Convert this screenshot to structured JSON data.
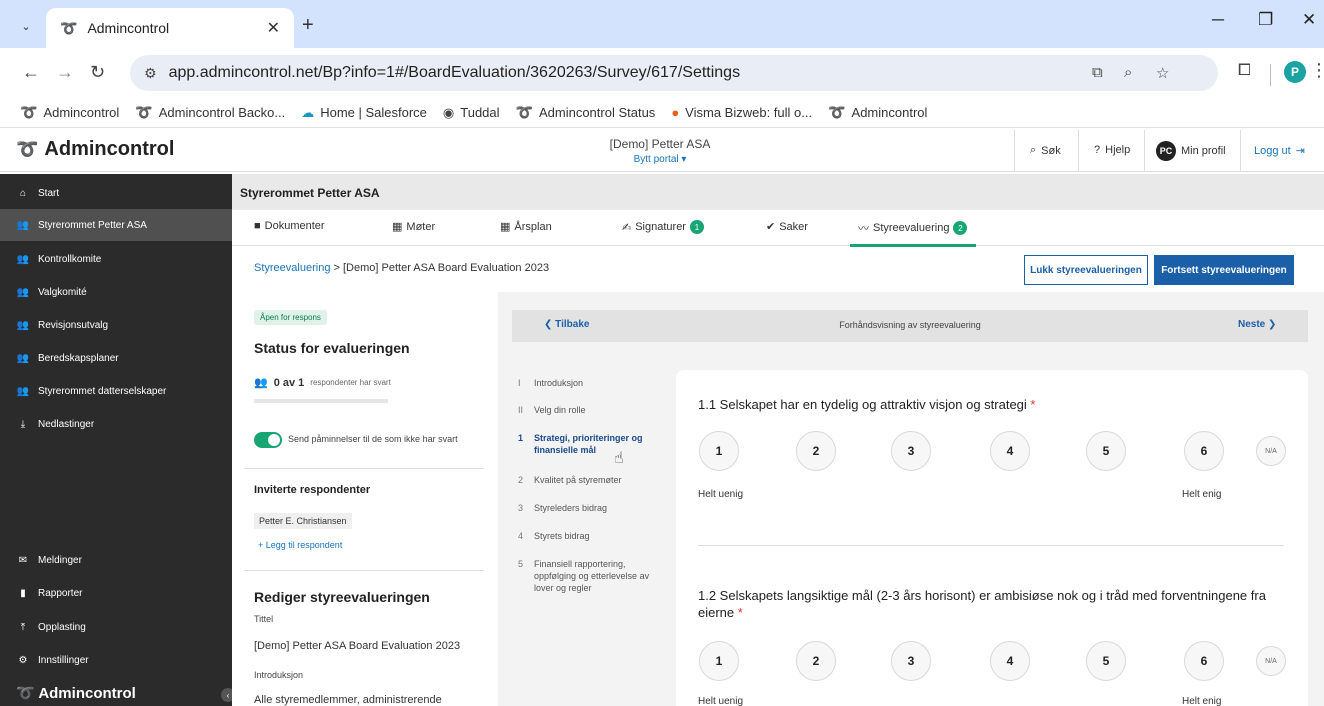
{
  "browser": {
    "tab_title": "Admincontrol",
    "url": "app.admincontrol.net/Bp?info=1#/BoardEvaluation/3620263/Survey/617/Settings",
    "profile_initial": "P",
    "bookmarks": [
      {
        "label": "Admincontrol",
        "icon": "admincontrol-swirl-icon"
      },
      {
        "label": "Admincontrol Backo...",
        "icon": "admincontrol-swirl-icon"
      },
      {
        "label": "Home | Salesforce",
        "icon": "salesforce-cloud-icon"
      },
      {
        "label": "Tuddal",
        "icon": "globe-icon"
      },
      {
        "label": "Admincontrol Status",
        "icon": "admincontrol-swirl-icon"
      },
      {
        "label": "Visma Bizweb: full o...",
        "icon": "visma-icon"
      },
      {
        "label": "Admincontrol",
        "icon": "admincontrol-swirl-icon"
      }
    ]
  },
  "header": {
    "brand": "Admincontrol",
    "org": "[Demo] Petter ASA",
    "switch_portal": "Bytt portal ▾",
    "search": "Søk",
    "help": "Hjelp",
    "profile_initials": "PC",
    "profile": "Min profil",
    "logout": "Logg ut"
  },
  "sidebar": {
    "items": [
      {
        "label": "Start",
        "icon": "home-icon"
      },
      {
        "label": "Styrerommet Petter ASA",
        "icon": "group-icon"
      },
      {
        "label": "Kontrollkomite",
        "icon": "group-icon"
      },
      {
        "label": "Valgkomité",
        "icon": "group-icon"
      },
      {
        "label": "Revisjonsutvalg",
        "icon": "group-icon"
      },
      {
        "label": "Beredskapsplaner",
        "icon": "group-icon"
      },
      {
        "label": "Styrerommet datterselskaper",
        "icon": "group-icon"
      },
      {
        "label": "Nedlastinger",
        "icon": "download-icon"
      }
    ],
    "bottom_items": [
      {
        "label": "Meldinger",
        "icon": "mail-icon"
      },
      {
        "label": "Rapporter",
        "icon": "bar-chart-icon"
      },
      {
        "label": "Opplasting",
        "icon": "upload-icon"
      },
      {
        "label": "Innstillinger",
        "icon": "gear-icon"
      }
    ],
    "brand": "Admincontrol"
  },
  "main": {
    "room_title": "Styrerommet Petter ASA",
    "tabs": [
      {
        "label": "Dokumenter",
        "icon": "folder-icon"
      },
      {
        "label": "Møter",
        "icon": "calendar-icon"
      },
      {
        "label": "Årsplan",
        "icon": "calendar-icon"
      },
      {
        "label": "Signaturer",
        "icon": "signature-icon",
        "badge": "1"
      },
      {
        "label": "Saker",
        "icon": "check-icon"
      },
      {
        "label": "Styreevaluering",
        "icon": "trend-icon",
        "badge": "2"
      }
    ],
    "breadcrumb_link": "Styreevaluering",
    "breadcrumb_sep": ">",
    "breadcrumb_current": "[Demo] Petter ASA Board Evaluation 2023",
    "btn_close": "Lukk styreevalueringen",
    "btn_continue": "Fortsett styreevalueringen"
  },
  "status": {
    "badge": "Åpen for respons",
    "title": "Status for evalueringen",
    "responded": "0 av 1",
    "responded_suffix": "respondenter har svart",
    "progress_fraction": 0,
    "reminder_label": "Send påminnelser til de som ikke har svart",
    "reminder_on": true,
    "invited_title": "Inviterte respondenter",
    "invited": [
      "Petter E. Christiansen"
    ],
    "add_respondent": "+ Legg til respondent",
    "edit_title": "Rediger styreevalueringen",
    "field_title_label": "Tittel",
    "field_title_value": "[Demo] Petter ASA Board Evaluation 2023",
    "field_intro_label": "Introduksjon",
    "field_intro_value": "Alle styremedlemmer, administrerende"
  },
  "preview": {
    "back": "Tilbake",
    "title": "Forhåndsvisning av styreevaluering",
    "next": "Neste",
    "steps": [
      {
        "n": "I",
        "label": "Introduksjon"
      },
      {
        "n": "II",
        "label": "Velg din rolle"
      },
      {
        "n": "1",
        "label": "Strategi, prioriteringer og finansielle mål",
        "active": true
      },
      {
        "n": "2",
        "label": "Kvalitet på styremøter"
      },
      {
        "n": "3",
        "label": "Styreleders bidrag"
      },
      {
        "n": "4",
        "label": "Styrets bidrag"
      },
      {
        "n": "5",
        "label": "Finansiell rapportering, oppfølging og etterlevelse av lover og regler"
      }
    ],
    "questions": [
      {
        "text": "1.1 Selskapet har en tydelig og attraktiv visjon og strategi",
        "required": "*",
        "low": "Helt uenig",
        "high": "Helt enig"
      },
      {
        "text": "1.2 Selskapets langsiktige mål (2-3 års horisont) er ambisiøse nok og i tråd med forventningene fra eierne",
        "required": "*",
        "low": "Helt uenig",
        "high": "Helt enig"
      }
    ],
    "scale": [
      "1",
      "2",
      "3",
      "4",
      "5",
      "6"
    ],
    "na": "N/A"
  },
  "colors": {
    "accent_green": "#17a673",
    "primary_blue": "#1a5fa8",
    "sidebar_bg": "#2b2b2b"
  }
}
